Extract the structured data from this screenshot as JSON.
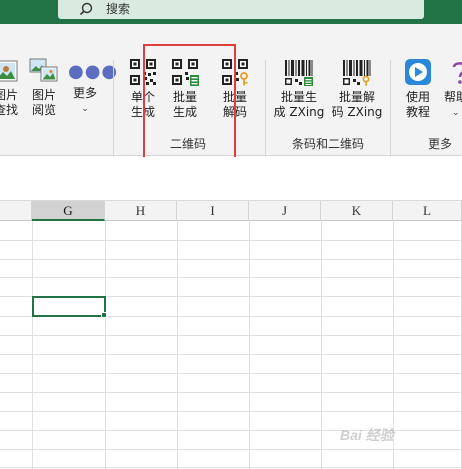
{
  "search": {
    "placeholder": "搜索"
  },
  "ribbon": {
    "buttons": {
      "find_images": {
        "line1": "图片",
        "line2": "查找"
      },
      "image_browse": {
        "line1": "图片",
        "line2": "阅览"
      },
      "more": {
        "label": "更多"
      },
      "single_gen": {
        "line1": "单个",
        "line2": "生成"
      },
      "batch_gen": {
        "line1": "批量",
        "line2": "生成"
      },
      "batch_decode": {
        "line1": "批量",
        "line2": "解码"
      },
      "batch_gen_zxing": {
        "line1": "批量生",
        "line2": "成 ZXing"
      },
      "batch_decode_zxing": {
        "line1": "批量解",
        "line2": "码 ZXing"
      },
      "tutorial": {
        "line1": "使用",
        "line2": "教程"
      },
      "help": {
        "line1": "帮助"
      }
    },
    "groups": {
      "qrcode": "二维码",
      "barcode_qr": "条码和二维码",
      "more": "更多"
    }
  },
  "grid": {
    "columns": [
      "G",
      "H",
      "I",
      "J",
      "K",
      "L"
    ],
    "active_column": "G"
  },
  "watermark": {
    "text": "Bai 经验"
  },
  "colors": {
    "titlebar": "#217346",
    "accent": "#217346",
    "highlight": "#e0403c"
  }
}
